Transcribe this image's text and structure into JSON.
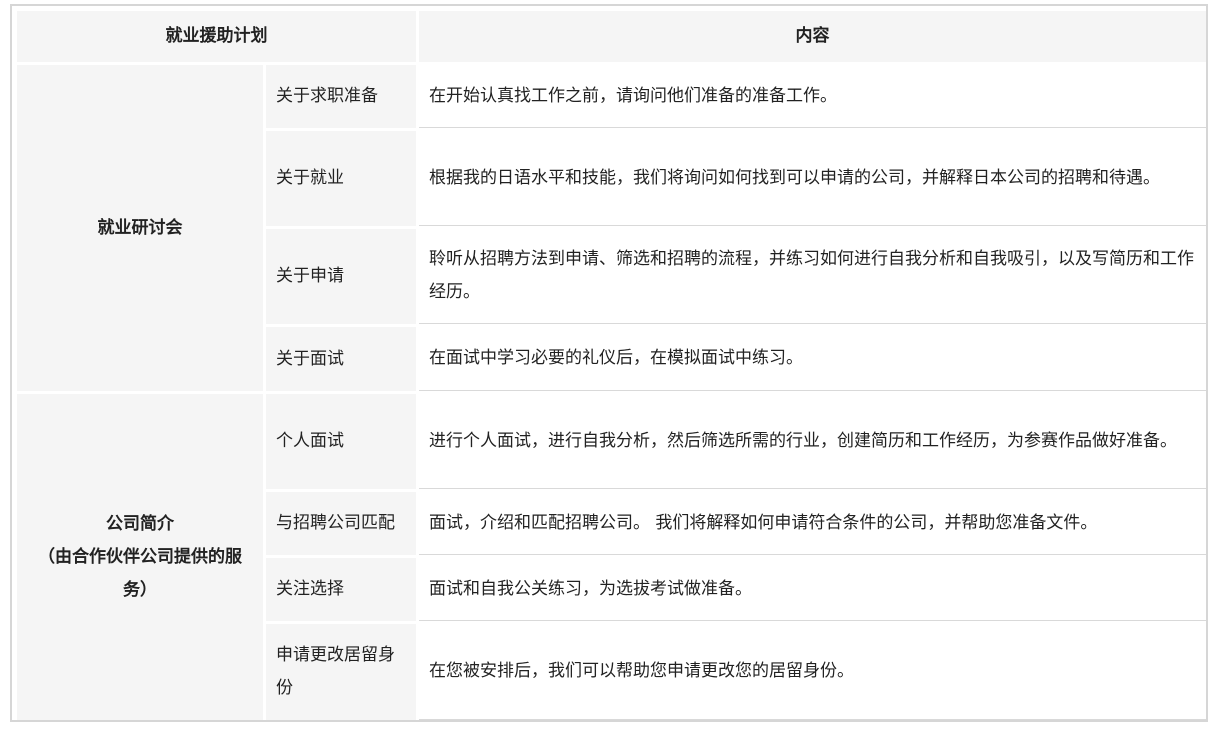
{
  "header": {
    "col_plan": "就业援助计划",
    "col_content": "内容"
  },
  "groups": [
    {
      "title": "就业研讨会",
      "items": [
        {
          "name": "关于求职准备",
          "content": "在开始认真找工作之前，请询问他们准备的准备工作。"
        },
        {
          "name": "关于就业",
          "content": "根据我的日语水平和技能，我们将询问如何找到可以申请的公司，并解释日本公司的招聘和待遇。"
        },
        {
          "name": "关于申请",
          "content": "聆听从招聘方法到申请、筛选和招聘的流程，并练习如何进行自我分析和自我吸引，以及写简历和工作经历。"
        },
        {
          "name": "关于面试",
          "content": "在面试中学习必要的礼仪后，在模拟面试中练习。"
        }
      ]
    },
    {
      "title": "公司简介",
      "subtitle": "（由合作伙伴公司提供的服务）",
      "items": [
        {
          "name": "个人面试",
          "content": "进行个人面试，进行自我分析，然后筛选所需的行业，创建简历和工作经历，为参赛作品做好准备。"
        },
        {
          "name": "与招聘公司匹配",
          "content": "面试，介绍和匹配招聘公司。 我们将解释如何申请符合条件的公司，并帮助您准备文件。"
        },
        {
          "name": "关注选择",
          "content": "面试和自我公关练习，为选拔考试做准备。"
        },
        {
          "name": "申请更改居留身份",
          "content": "在您被安排后，我们可以帮助您申请更改您的居留身份。"
        }
      ]
    }
  ]
}
